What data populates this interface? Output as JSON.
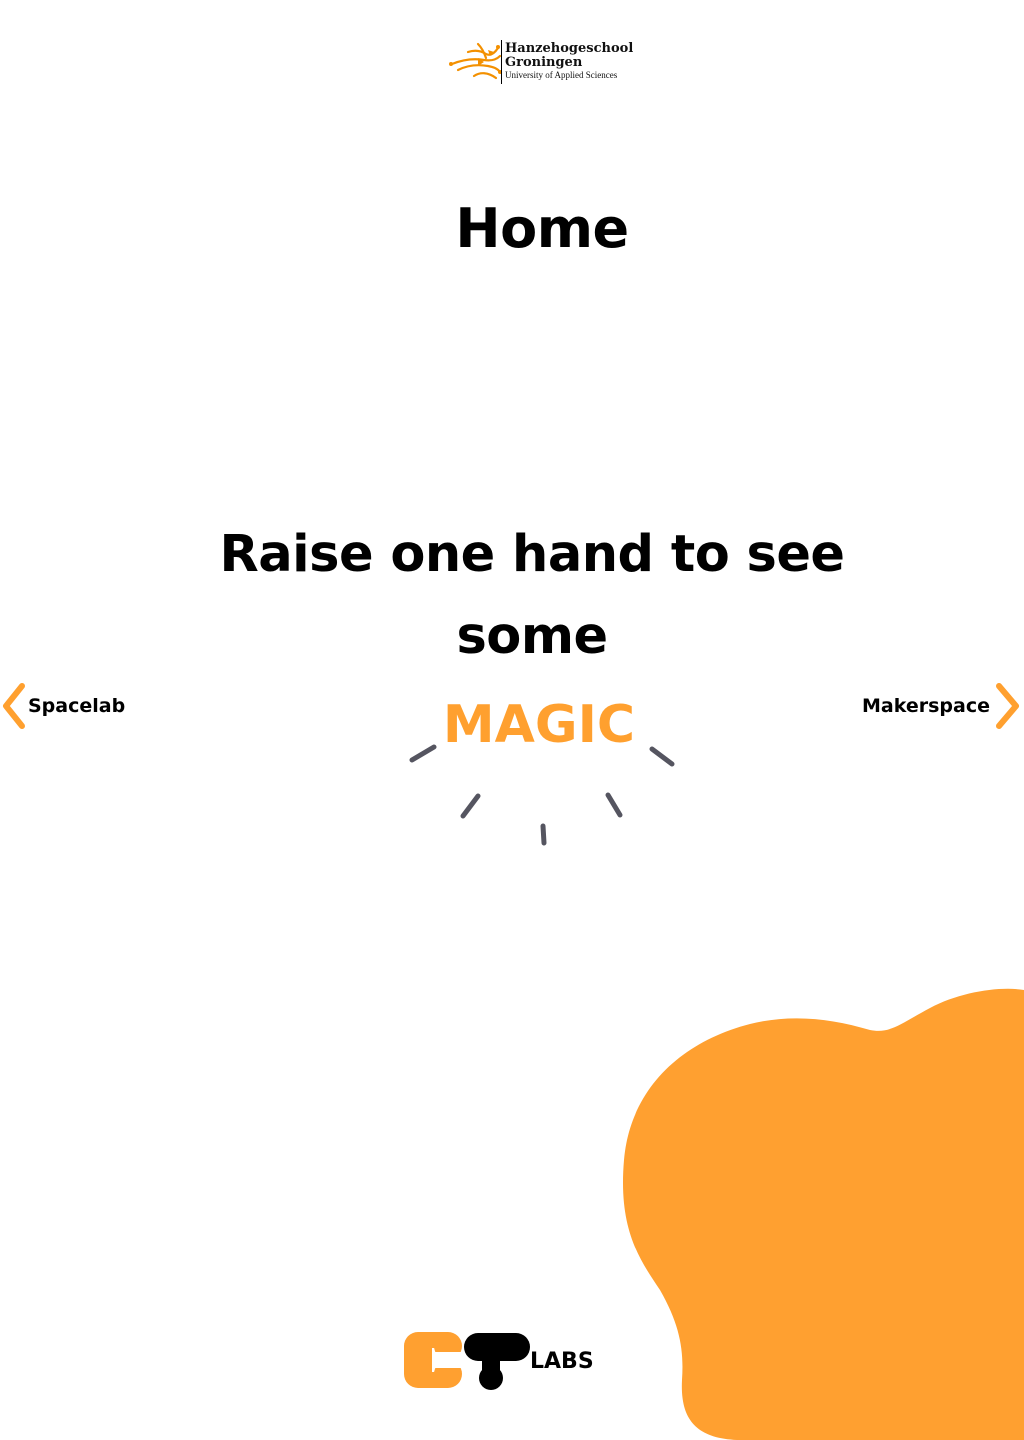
{
  "header": {
    "logo": {
      "name_line1": "Hanzehogeschool",
      "name_line2": "Groningen",
      "subtitle": "University of Applied Sciences",
      "accent_color": "#f39000"
    }
  },
  "page": {
    "title": "Home",
    "prompt": "Raise one hand to see some",
    "highlight": "MAGIC",
    "highlight_color": "#ffa02f"
  },
  "navigation": {
    "previous": {
      "label": "Spacelab",
      "icon": "chevron-left-icon"
    },
    "next": {
      "label": "Makerspace",
      "icon": "chevron-right-icon"
    },
    "chevron_color": "#ffa02f"
  },
  "decoration": {
    "rays_icon": "burst-rays-icon",
    "rays_color": "#555560",
    "blob_color": "#ffa030"
  },
  "footer": {
    "logo": {
      "text": "LABS",
      "mark_icon": "ct-logo-mark",
      "orange": "#ffa030",
      "black": "#000000"
    }
  }
}
